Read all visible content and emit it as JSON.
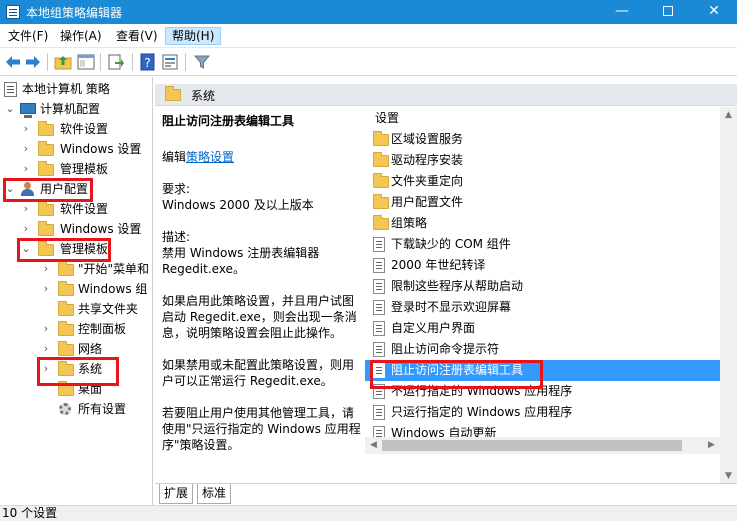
{
  "window": {
    "title": "本地组策略编辑器",
    "minimize": "—",
    "close": "✕"
  },
  "menu": [
    {
      "label": "文件(F)"
    },
    {
      "label": "操作(A)"
    },
    {
      "label": "查看(V)"
    },
    {
      "label": "帮助(H)"
    }
  ],
  "toolbar": {
    "icons": [
      "back-arrow-icon",
      "forward-arrow-icon",
      "folder-up-icon",
      "console-tree-icon",
      "export-list-icon",
      "help-icon",
      "properties-icon",
      "filter-icon"
    ]
  },
  "tree": {
    "root": "本地计算机 策略",
    "computer_config": "计算机配置",
    "software_settings_1": "软件设置",
    "windows_settings_1": "Windows 设置",
    "admin_templates_1": "管理模板",
    "user_config": "用户配置",
    "software_settings_2": "软件设置",
    "windows_settings_2": "Windows 设置",
    "admin_templates_2": "管理模板",
    "start_menu": "\"开始\"菜单和",
    "windows_components": "Windows 组",
    "shared_folders": "共享文件夹",
    "control_panel": "控制面板",
    "network": "网络",
    "system": "系统",
    "desktop": "桌面",
    "all_settings": "所有设置"
  },
  "details": {
    "header": "系统",
    "policy_title": "阻止访问注册表编辑工具",
    "edit_prefix": "编辑",
    "edit_link": "策略设置",
    "requirements_label": "要求:",
    "requirements_value": "Windows 2000 及以上版本",
    "description_label": "描述:",
    "description_value": "禁用 Windows 注册表编辑器 Regedit.exe。",
    "paragraph_enabled": "如果启用此策略设置，并且用户试图启动 Regedit.exe，则会出现一条消息，说明策略设置会阻止此操作。",
    "paragraph_disabled": "如果禁用或未配置此策略设置，则用户可以正常运行 Regedit.exe。",
    "paragraph_other": "若要阻止用户使用其他管理工具，请使用\"只运行指定的 Windows 应用程序\"策略设置。"
  },
  "list": {
    "column_header": "设置",
    "items": [
      {
        "label": "区域设置服务",
        "kind": "folder"
      },
      {
        "label": "驱动程序安装",
        "kind": "folder"
      },
      {
        "label": "文件夹重定向",
        "kind": "folder"
      },
      {
        "label": "用户配置文件",
        "kind": "folder"
      },
      {
        "label": "组策略",
        "kind": "folder"
      },
      {
        "label": "下载缺少的 COM 组件",
        "kind": "setting"
      },
      {
        "label": "2000 年世纪转译",
        "kind": "setting"
      },
      {
        "label": "限制这些程序从帮助启动",
        "kind": "setting"
      },
      {
        "label": "登录时不显示欢迎屏幕",
        "kind": "setting"
      },
      {
        "label": "自定义用户界面",
        "kind": "setting"
      },
      {
        "label": "阻止访问命令提示符",
        "kind": "setting"
      },
      {
        "label": "阻止访问注册表编辑工具",
        "kind": "setting",
        "selected": true
      },
      {
        "label": "不运行指定的 Windows 应用程序",
        "kind": "setting"
      },
      {
        "label": "只运行指定的 Windows 应用程序",
        "kind": "setting"
      },
      {
        "label": "Windows 自动更新",
        "kind": "setting"
      }
    ]
  },
  "tabs": {
    "extended": "扩展",
    "standard": "标准"
  },
  "status": {
    "text": "10 个设置"
  },
  "colors": {
    "titlebar": "#1a8ad6",
    "selection": "#3399ff",
    "highlight_box": "#e8141c",
    "link": "#0066cc"
  }
}
